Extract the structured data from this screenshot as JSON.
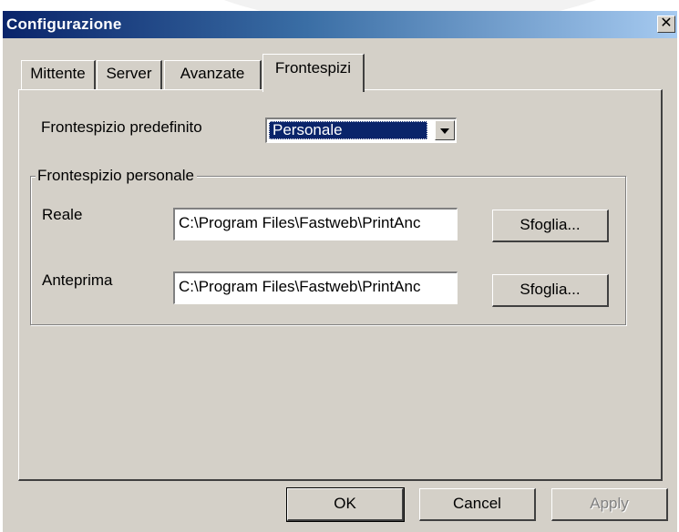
{
  "window": {
    "title": "Configurazione",
    "close_glyph": "✕"
  },
  "tabs": [
    {
      "label": "Mittente",
      "active": false
    },
    {
      "label": "Server",
      "active": false
    },
    {
      "label": "Avanzate",
      "active": false
    },
    {
      "label": "Frontespizi",
      "active": true
    }
  ],
  "frontespizio": {
    "default_label": "Frontespizio predefinito",
    "default_value": "Personale",
    "group_title": "Frontespizio personale",
    "fields": [
      {
        "label": "Reale",
        "value": "C:\\Program Files\\Fastweb\\PrintAnc",
        "browse_label": "Sfoglia..."
      },
      {
        "label": "Anteprima",
        "value": "C:\\Program Files\\Fastweb\\PrintAnc",
        "browse_label": "Sfoglia..."
      }
    ]
  },
  "buttons": {
    "ok": "OK",
    "cancel": "Cancel",
    "apply": "Apply"
  },
  "colors": {
    "titlebar_start": "#0a246a",
    "titlebar_end": "#a6caf0",
    "face": "#d4d0c8",
    "selection": "#0a246a"
  }
}
